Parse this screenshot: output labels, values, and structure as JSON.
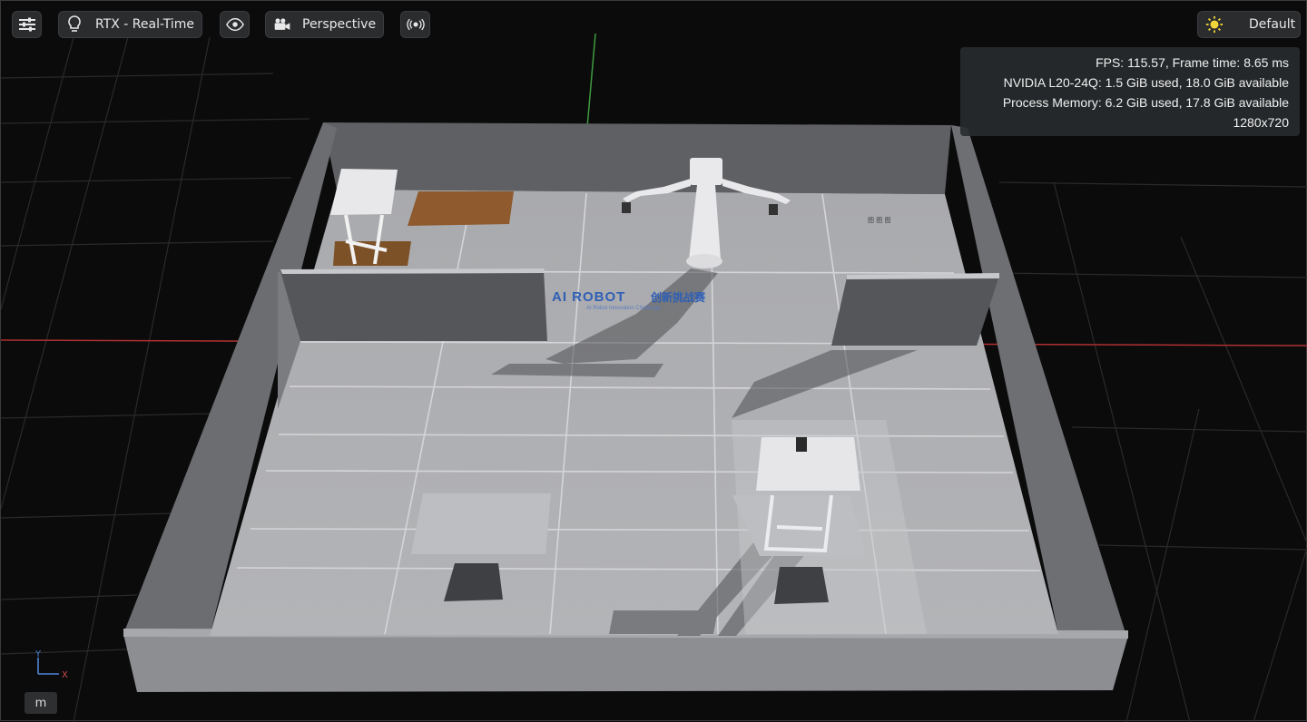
{
  "toolbar": {
    "settings_icon": "sliders-icon",
    "renderer_icon": "lightbulb-icon",
    "renderer_label": "RTX - Real-Time",
    "visibility_icon": "eye-icon",
    "camera_icon": "movie-camera-icon",
    "camera_label": "Perspective",
    "broadcast_icon": "broadcast-icon",
    "lighting_icon": "sun-icon",
    "lighting_label": "Default"
  },
  "stats": {
    "fps_line": "FPS: 115.57, Frame time: 8.65 ms",
    "gpu_line": "NVIDIA L20-24Q: 1.5 GiB used, 18.0 GiB available",
    "memory_line": "Process Memory: 6.2 GiB used, 17.8 GiB available",
    "resolution_line": "1280x720"
  },
  "scene": {
    "floor_logo": "AI ROBOT",
    "floor_logo_cn": "创新挑战赛",
    "floor_sublogo": "AI Robot Innovation Challenge",
    "wall_sign": "图 图 图"
  },
  "axis": {
    "y_label": "Y",
    "x_label": "X"
  },
  "units": {
    "label": "m"
  },
  "colors": {
    "accent_sun": "#f1d33a",
    "grid_red": "#b03030",
    "grid_green": "#3f9b3f"
  }
}
